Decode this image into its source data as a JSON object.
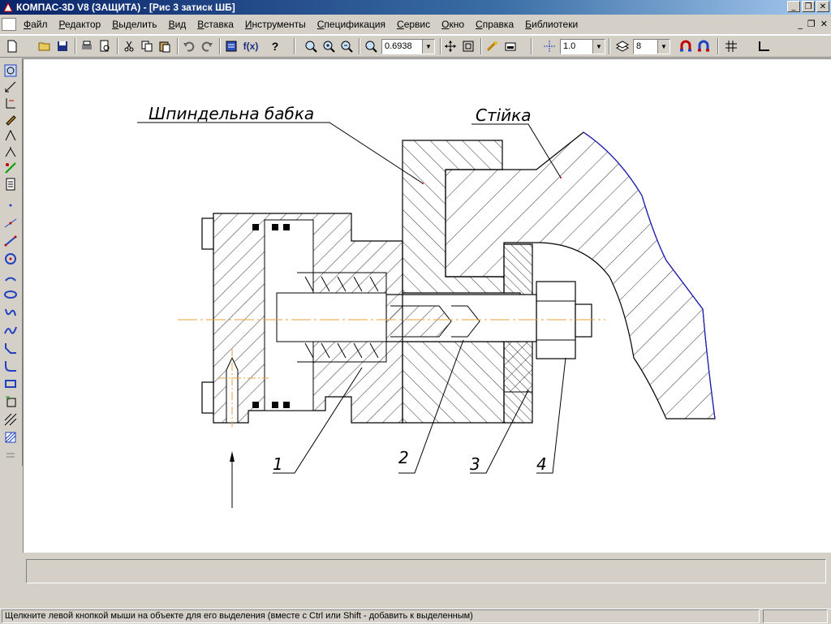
{
  "window": {
    "title": "КОМПАС-3D V8 (ЗАЩИТА) - [Рис 3 затиск ШБ]"
  },
  "window_buttons": {
    "minimize": "_",
    "maximize": "❐",
    "close": "✕"
  },
  "doc_buttons": {
    "minimize": "_",
    "restore": "❐",
    "close": "✕"
  },
  "menu": {
    "items": [
      "Файл",
      "Редактор",
      "Выделить",
      "Вид",
      "Вставка",
      "Инструменты",
      "Спецификация",
      "Сервис",
      "Окно",
      "Справка",
      "Библиотеки"
    ]
  },
  "toolbar": {
    "zoom_value": "0.6938",
    "step_value": "1.0",
    "layer_value": "8",
    "fx_label": "f(x)",
    "help_label": "?"
  },
  "drawing": {
    "label_headstock": "Шпиндельна бабка",
    "label_column": "Стійка",
    "callouts": [
      "1",
      "2",
      "3",
      "4"
    ]
  },
  "status": {
    "message": "Щелкните левой кнопкой мыши на объекте для его выделения (вместе с Ctrl или Shift - добавить к выделенным)"
  },
  "colors": {
    "titlebar_start": "#0a246a",
    "axis_line": "#e8a040",
    "contour_blue": "#2020c0"
  }
}
